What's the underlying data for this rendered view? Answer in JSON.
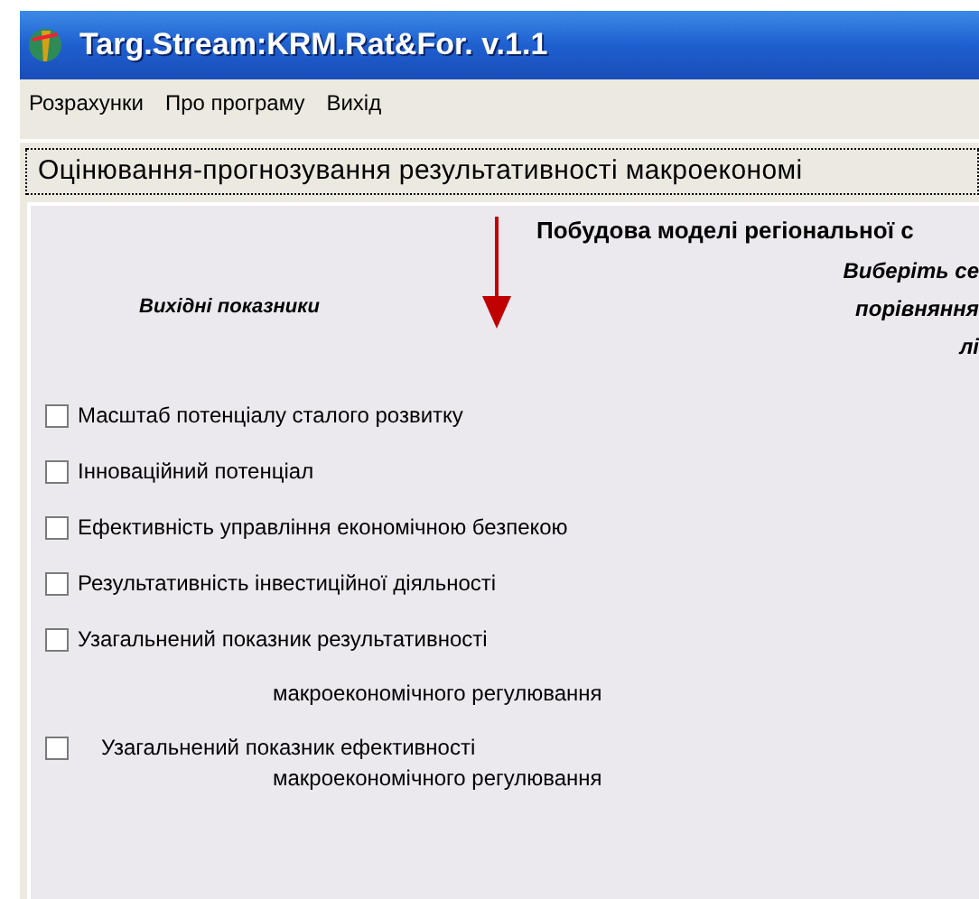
{
  "window": {
    "title": "Targ.Stream:KRM.Rat&For. v.1.1"
  },
  "menu": [
    {
      "label": "Розрахунки"
    },
    {
      "label": "Про програму"
    },
    {
      "label": "Вихід"
    }
  ],
  "group_tab": {
    "label": "Оцінювання-прогнозування результативності макроекономі"
  },
  "panel": {
    "heading": "Побудова моделі регіональної с",
    "instruction_lines": [
      "Виберіть се",
      "порівняння",
      "лі"
    ],
    "source_heading": "Вихідні показники"
  },
  "indicators": [
    {
      "kind": "single",
      "label": "Масштаб потенціалу сталого розвитку",
      "checked": false
    },
    {
      "kind": "single",
      "label": "Інноваційний потенціал",
      "checked": false
    },
    {
      "kind": "single",
      "label": "Ефективність управління економічною безпекою",
      "checked": false
    },
    {
      "kind": "single",
      "label": "Результативність інвестиційної діяльності",
      "checked": false
    },
    {
      "kind": "wrapped",
      "label": "Узагальнений показник результативності",
      "label_line_2": "макроекономічного регулювання",
      "checked": false
    },
    {
      "kind": "wrapped_indented",
      "label": "Узагальнений показник ефективності",
      "label_line_2": "макроекономічного регулювання",
      "checked": false
    }
  ]
}
